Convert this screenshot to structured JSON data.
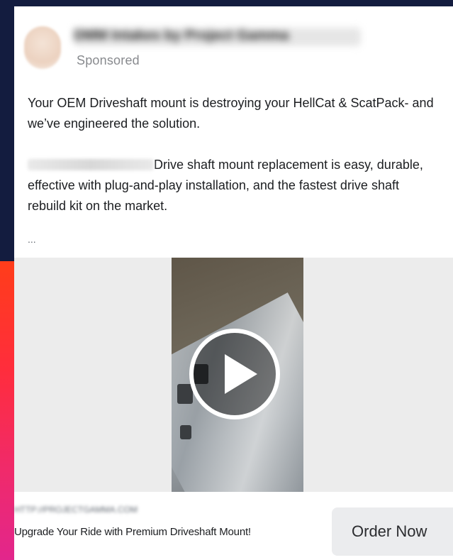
{
  "ad": {
    "advertiser": "DMM Intakes by Project Gamma",
    "sponsored_label": "Sponsored",
    "body": {
      "line1": "Your OEM Driveshaft mount is destroying your HellCat & ScatPack- and we’ve engineered the solution.",
      "line2_rest": "Drive shaft mount replacement is easy, durable, effective with plug-and-play installation, and the fastest drive shaft rebuild kit on the market.",
      "ellipsis": "..."
    },
    "media": {
      "type": "video",
      "play_icon": "play-icon"
    },
    "link": {
      "domain": "HTTP://PROJECTGAMMA.COM",
      "headline": "Upgrade Your Ride with Premium Driveshaft Mount!",
      "cta_label": "Order Now"
    }
  },
  "colors": {
    "card_bg": "#ffffff",
    "edge_navy": "#131c3f",
    "edge_red": "#ff3d1a",
    "edge_pink": "#e2268c",
    "cta_bg": "#ebecee",
    "secondary_text": "#888a8e"
  }
}
